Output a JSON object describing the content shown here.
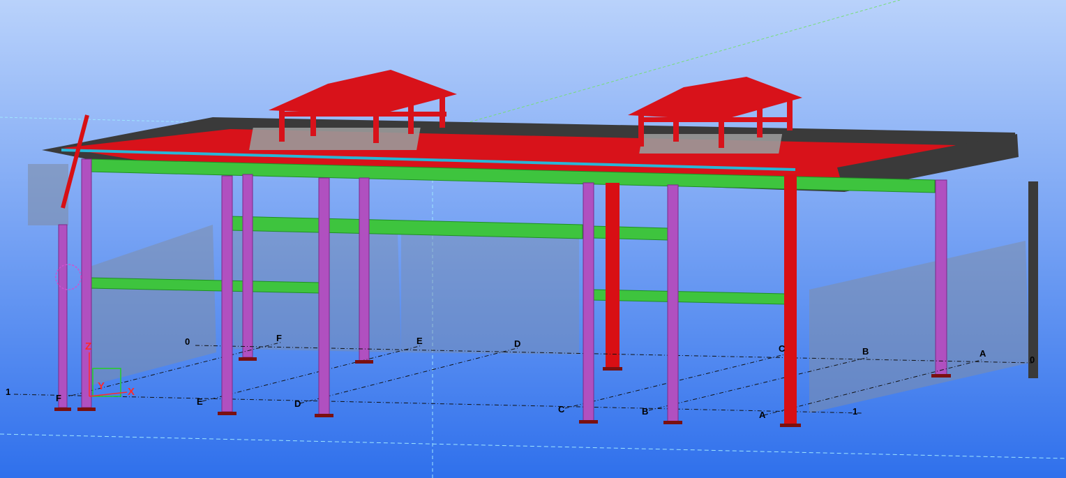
{
  "colors": {
    "background_top": "#b9d2fb",
    "background_bottom": "#2f70ec",
    "column_magenta": "#b050c0",
    "column_magenta_dark": "#7a2a88",
    "column_red": "#d80f14",
    "beam_green": "#3ec43e",
    "beam_green_dark": "#1f8f23",
    "roof_red": "#d8121a",
    "roof_dark": "#3a3a3a",
    "wall_gray": "#7f8ea8",
    "grid_line": "#111111",
    "axis_x": "#ff2a2a",
    "axis_y": "#ff2a2a",
    "axis_z": "#ff2a2a",
    "guide_green": "#77dd77",
    "guide_cyan": "#9fe6ff"
  },
  "grid_labels": {
    "front_row": [
      "1",
      "F",
      "E",
      "D",
      "C",
      "B",
      "A",
      "1"
    ],
    "back_row": [
      "0",
      "F",
      "E",
      "D",
      "C",
      "B",
      "A",
      "0"
    ]
  },
  "axes": {
    "x": "X",
    "y": "Y",
    "z": "Z"
  }
}
